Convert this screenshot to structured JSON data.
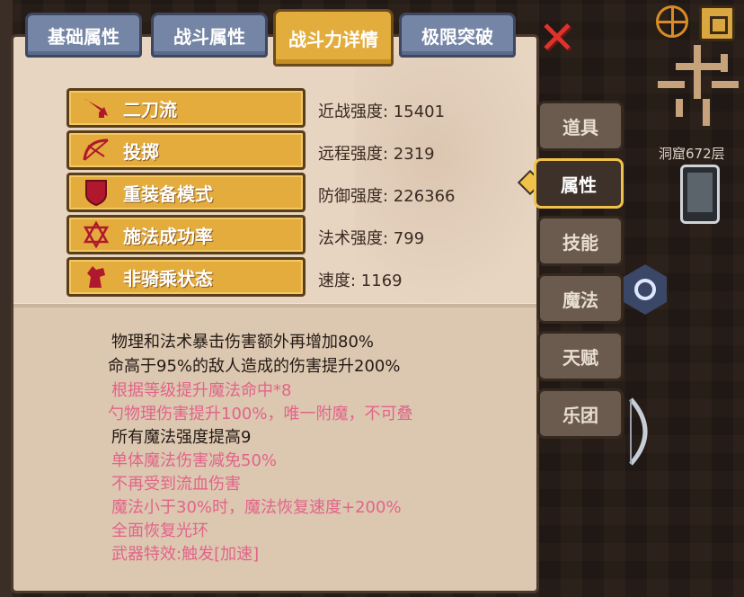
{
  "tabs": [
    {
      "label": "基础属性",
      "active": false
    },
    {
      "label": "战斗属性",
      "active": false
    },
    {
      "label": "战斗力详情",
      "active": true
    },
    {
      "label": "极限突破",
      "active": false
    }
  ],
  "skills": [
    {
      "icon": "sword-icon",
      "label": "二刀流",
      "stat": "近战强度: 15401"
    },
    {
      "icon": "bow-icon",
      "label": "投掷",
      "stat": "远程强度: 2319"
    },
    {
      "icon": "shield-icon",
      "label": "重装备模式",
      "stat": "防御强度: 226366"
    },
    {
      "icon": "hexagram-icon",
      "label": "施法成功率",
      "stat": "法术强度: 799"
    },
    {
      "icon": "horse-head-icon",
      "label": "非骑乘状态",
      "stat": "速度: 1169"
    }
  ],
  "description": [
    {
      "text": "物理和法术暴击伤害额外再增加80%",
      "color": "black"
    },
    {
      "text": "命高于95%的敌人造成的伤害提升200%",
      "color": "black"
    },
    {
      "text": "根据等级提升魔法命中*8",
      "color": "pink"
    },
    {
      "text": "勺物理伤害提升100%，唯一附魔，不可叠",
      "color": "pink"
    },
    {
      "text": "所有魔法强度提高9",
      "color": "black"
    },
    {
      "text": "单体魔法伤害减免50%",
      "color": "pink"
    },
    {
      "text": "不再受到流血伤害",
      "color": "pink"
    },
    {
      "text": "魔法小于30%时，魔法恢复速度+200%",
      "color": "pink"
    },
    {
      "text": "全面恢复光环",
      "color": "pink"
    },
    {
      "text": "武器特效:触发[加速]",
      "color": "pink"
    }
  ],
  "side_menu": [
    {
      "label": "道具",
      "active": false
    },
    {
      "label": "属性",
      "active": true
    },
    {
      "label": "技能",
      "active": false
    },
    {
      "label": "魔法",
      "active": false
    },
    {
      "label": "天赋",
      "active": false
    },
    {
      "label": "乐团",
      "active": false
    }
  ],
  "hud": {
    "floor_text": "洞窟672层"
  },
  "colors": {
    "tab_inactive": "#7585a6",
    "tab_active": "#e2ad3c",
    "skill_button": "#e4ac3c",
    "pink_text": "#e26489",
    "close_x": "#e0322b"
  }
}
